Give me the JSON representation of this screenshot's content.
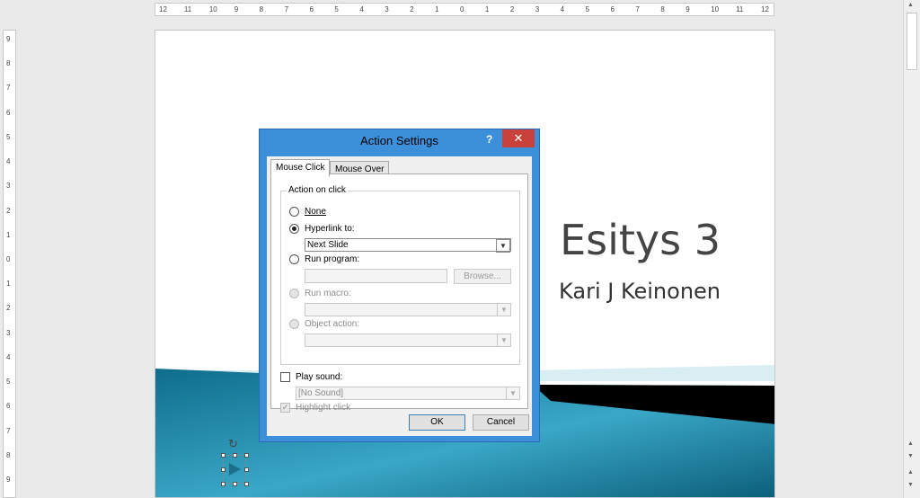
{
  "ruler_h_ticks": [
    "12",
    "11",
    "10",
    "9",
    "8",
    "7",
    "6",
    "5",
    "4",
    "3",
    "2",
    "1",
    "0",
    "1",
    "2",
    "3",
    "4",
    "5",
    "6",
    "7",
    "8",
    "9",
    "10",
    "11",
    "12"
  ],
  "ruler_v_ticks": [
    "9",
    "8",
    "7",
    "6",
    "5",
    "4",
    "3",
    "2",
    "1",
    "0",
    "1",
    "2",
    "3",
    "4",
    "5",
    "6",
    "7",
    "8",
    "9"
  ],
  "slide": {
    "title": "Esitys 3",
    "subtitle": "Kari J Keinonen"
  },
  "dialog": {
    "title": "Action Settings",
    "help": "?",
    "close": "✕",
    "tabs": [
      "Mouse Click",
      "Mouse Over"
    ],
    "group_label": "Action on click",
    "options": {
      "none": "None",
      "hyperlink": "Hyperlink to:",
      "run_program": "Run program:",
      "run_macro": "Run macro:",
      "object_action": "Object action:"
    },
    "hyperlink_value": "Next Slide",
    "browse": "Browse...",
    "play_sound": "Play sound:",
    "sound_value": "[No Sound]",
    "highlight_click": "Highlight click",
    "ok": "OK",
    "cancel": "Cancel"
  },
  "colors": {
    "accent": "#3c8fd9",
    "close": "#c8413a",
    "teal": "#1c7a96"
  },
  "icons": {
    "rotate": "rotate-icon",
    "action_button": "play-triangle-icon"
  }
}
